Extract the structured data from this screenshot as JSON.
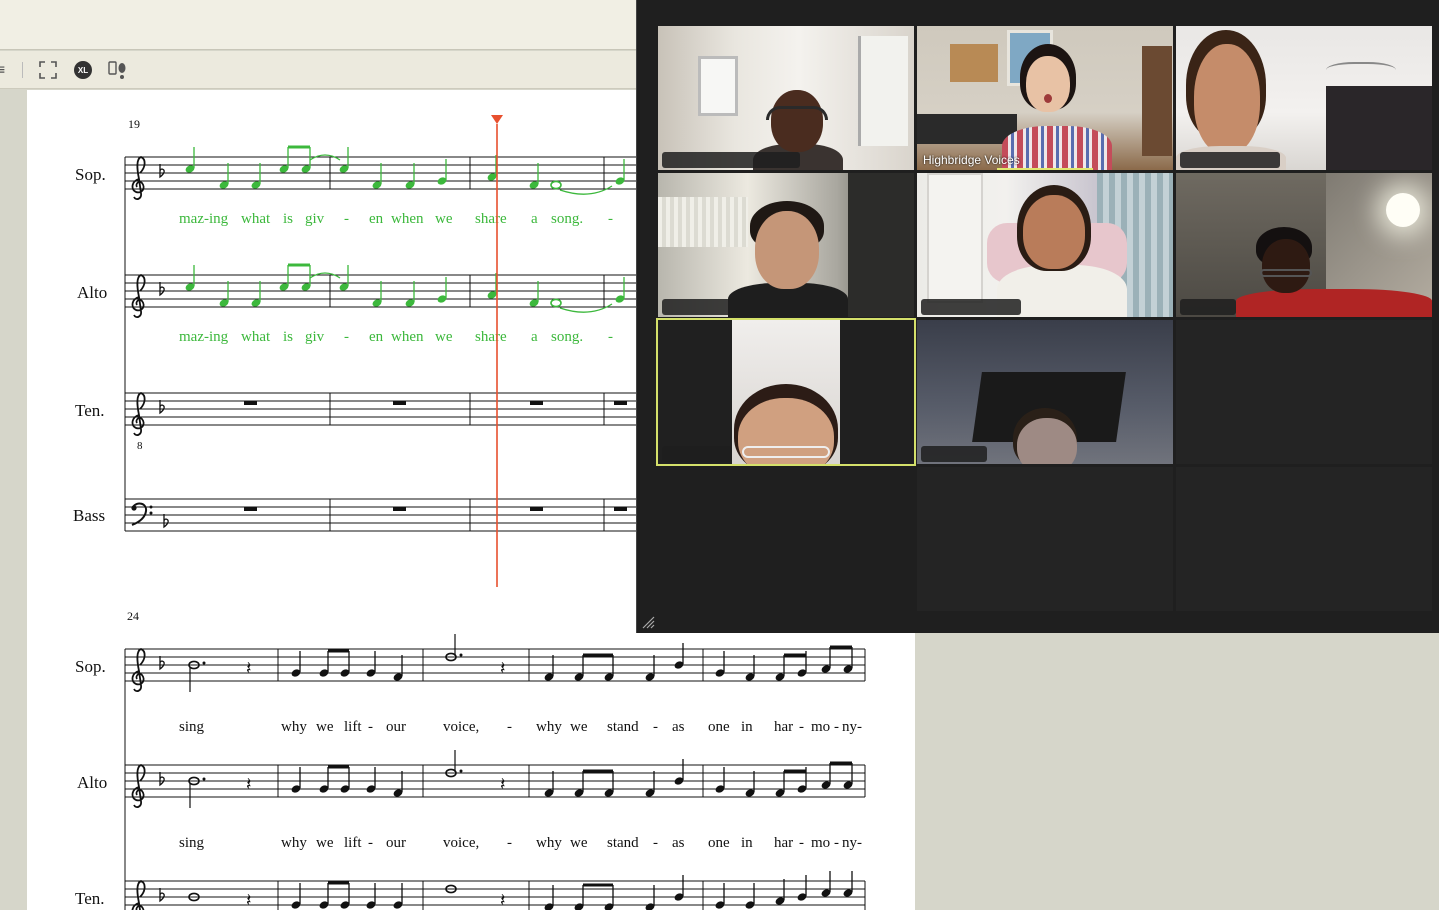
{
  "app": {
    "toolbar_icons": [
      "menu-icon",
      "fullscreen-icon",
      "xl-icon",
      "footsteps-icon"
    ],
    "xl_label": "XL"
  },
  "score": {
    "system1": {
      "measure_number": "19",
      "staves": [
        {
          "label": "Sop.",
          "lyrics": [
            "maz-ing",
            "what",
            "is",
            "giv",
            "-",
            "en",
            "when",
            "we",
            "share",
            "a",
            "song.",
            "-"
          ]
        },
        {
          "label": "Alto",
          "lyrics": [
            "maz-ing",
            "what",
            "is",
            "giv",
            "-",
            "en",
            "when",
            "we",
            "share",
            "a",
            "song.",
            "-"
          ]
        },
        {
          "label": "Ten."
        },
        {
          "label": "Bass"
        }
      ]
    },
    "system2": {
      "measure_number": "24",
      "staves": [
        {
          "label": "Sop.",
          "lyrics": [
            "sing",
            "why",
            "we",
            "lift",
            "-",
            "our",
            "voice,",
            "-",
            "why",
            "we",
            "stand",
            "-",
            "as",
            "one",
            "in",
            "har",
            "-",
            "mo",
            "-",
            "ny-"
          ]
        },
        {
          "label": "Alto",
          "lyrics": [
            "sing",
            "why",
            "we",
            "lift",
            "-",
            "our",
            "voice,",
            "-",
            "why",
            "we",
            "stand",
            "-",
            "as",
            "one",
            "in",
            "har",
            "-",
            "mo",
            "-",
            "ny-"
          ]
        },
        {
          "label": "Ten."
        }
      ]
    },
    "highlight_color": "#3cb83c",
    "playhead_color": "#e8502e"
  },
  "meeting": {
    "participants": [
      {
        "name": "",
        "active": false
      },
      {
        "name": "Highbridge Voices",
        "active": true
      },
      {
        "name": "",
        "active": false
      },
      {
        "name": "",
        "active": false
      },
      {
        "name": "",
        "active": false
      },
      {
        "name": "",
        "active": false
      },
      {
        "name": "",
        "active": false,
        "pinned": true
      },
      {
        "name": "",
        "active": false
      }
    ],
    "accent_color": "#d4e06a"
  }
}
